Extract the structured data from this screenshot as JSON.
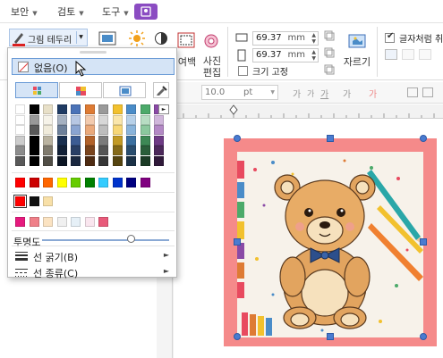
{
  "menubar": {
    "items": [
      {
        "label": "보안"
      },
      {
        "label": "검토"
      },
      {
        "label": "도구"
      }
    ]
  },
  "ribbon": {
    "line_button_label": "그림 테두리",
    "margin_label": "여백",
    "photo_edit_label": "사진\n편집",
    "width_value": "69.37",
    "height_value": "69.37",
    "unit": "mm",
    "lock_size_label": "크기 고정",
    "crop_label": "자르기",
    "wrap_label": "글자처럼 취"
  },
  "toolbar2": {
    "font_size": "10.0",
    "font_size_unit": "pt",
    "font_glyphs": [
      "가",
      "가",
      "가",
      "가",
      "가"
    ]
  },
  "panel": {
    "none_label": "없음(O)",
    "opacity_label": "투명도",
    "opacity_value": 0.7,
    "line_width_label": "선 굵기(B)",
    "line_type_label": "선 종류(C)",
    "palette": {
      "row1": [
        "#ffffff",
        "#000000",
        "#e8e0c8",
        "#1f3b63",
        "#4b73b8",
        "#de7b34",
        "#9a9a9a",
        "#f2c12e",
        "#4a8cc8",
        "#4caa6a",
        "#8a4aa6"
      ],
      "recent": [
        "#ff0000",
        "#cc0000",
        "#ff6600",
        "#ffff00",
        "#66cc00",
        "#008000",
        "#33ccff",
        "#0033cc",
        "#000080",
        "#800080"
      ],
      "custom": [
        "#ff0000",
        "#111111",
        "#f8e0a8"
      ],
      "extra": [
        "#e61a7e",
        "#ef7f88",
        "#fbe3c2",
        "#f0f0f0",
        "#e6f0f7",
        "#fae6ef",
        "#e85a7a"
      ]
    },
    "accent": "#6b9bd6"
  },
  "picture": {
    "border_color": "#f58a8a"
  }
}
